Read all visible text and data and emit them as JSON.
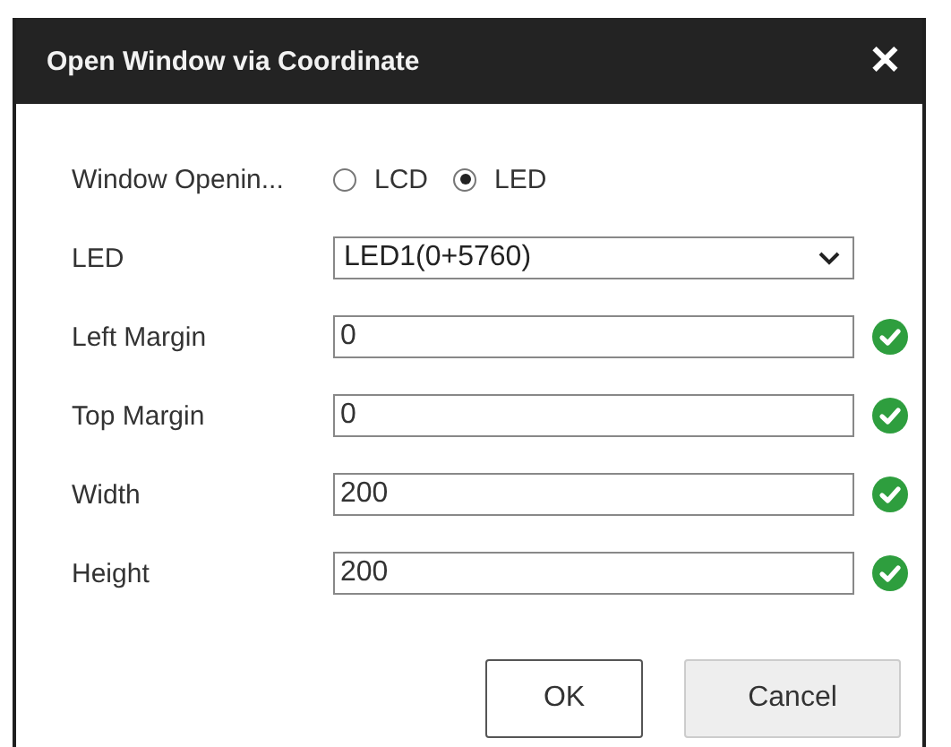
{
  "dialog": {
    "title": "Open Window via Coordinate",
    "close": "✕"
  },
  "fields": [
    {
      "kind": "radio",
      "label": "Window Openin...",
      "options": [
        {
          "label": "LCD",
          "selected": false
        },
        {
          "label": "LED",
          "selected": true
        }
      ]
    },
    {
      "kind": "select",
      "label": "LED",
      "value": "LED1(0+5760)"
    },
    {
      "kind": "input",
      "label": "Left Margin",
      "value": "0",
      "valid": true
    },
    {
      "kind": "input",
      "label": "Top Margin",
      "value": "0",
      "valid": true
    },
    {
      "kind": "input",
      "label": "Width",
      "value": "200",
      "valid": true
    },
    {
      "kind": "input",
      "label": "Height",
      "value": "200",
      "valid": true
    }
  ],
  "buttons": [
    {
      "label": "OK",
      "kind": "primary"
    },
    {
      "label": "Cancel",
      "kind": "secondary"
    }
  ]
}
